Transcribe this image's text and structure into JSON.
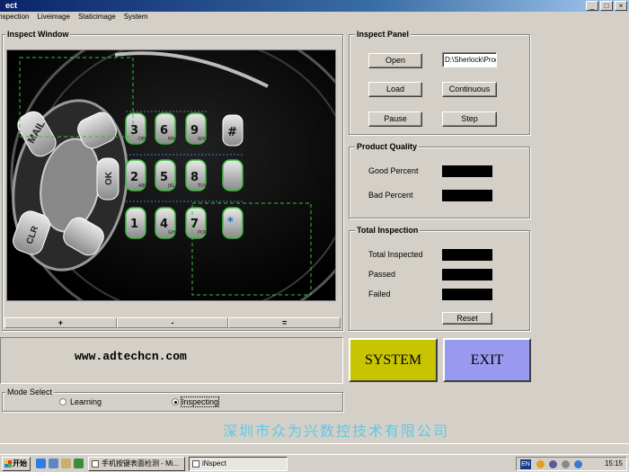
{
  "window": {
    "title": "ect",
    "controls": [
      "_",
      "□",
      "×"
    ]
  },
  "menu": [
    "Inspection",
    "Liveimage",
    "Staticimage",
    "System"
  ],
  "inspect_window": {
    "title": "Inspect Window",
    "zoom_buttons": [
      "+",
      "-",
      "="
    ]
  },
  "url": "www.adtechcn.com",
  "inspect_panel": {
    "title": "Inspect Panel",
    "open_label": "Open",
    "path_value": "D:\\Sherlock\\Prog",
    "load_label": "Load",
    "continuous_label": "Continuous",
    "pause_label": "Pause",
    "step_label": "Step"
  },
  "product_quality": {
    "title": "Product Quality",
    "good_label": "Good Percent",
    "bad_label": "Bad Percent"
  },
  "total_inspection": {
    "title": "Total Inspection",
    "total_label": "Total Inspected",
    "passed_label": "Passed",
    "failed_label": "Failed",
    "reset_label": "Reset"
  },
  "system_button": {
    "label": "SYSTEM",
    "color": "#c8c400"
  },
  "exit_button": {
    "label": "EXIT",
    "color": "#9999f0"
  },
  "mode_select": {
    "title": "Mode Select",
    "learning_label": "Learning",
    "inspecting_label": "Inspecting",
    "selected": "Inspecting"
  },
  "company": "深圳市众为兴数控技术有限公司",
  "taskbar": {
    "start_label": "开始",
    "tasks": [
      "手机按键表面检测 - Mi...",
      "iNspect"
    ],
    "language": "EN",
    "clock": "15:15"
  },
  "keypad": {
    "keys": [
      "MAIL",
      "OK",
      "CLR",
      "1",
      "2",
      "3",
      "4",
      "5",
      "6",
      "7",
      "8",
      "9",
      "*",
      "#",
      "ABC",
      "DEF",
      "GHI",
      "JKL",
      "MNO",
      "PQRS",
      "TUV",
      "WXYZ"
    ]
  }
}
